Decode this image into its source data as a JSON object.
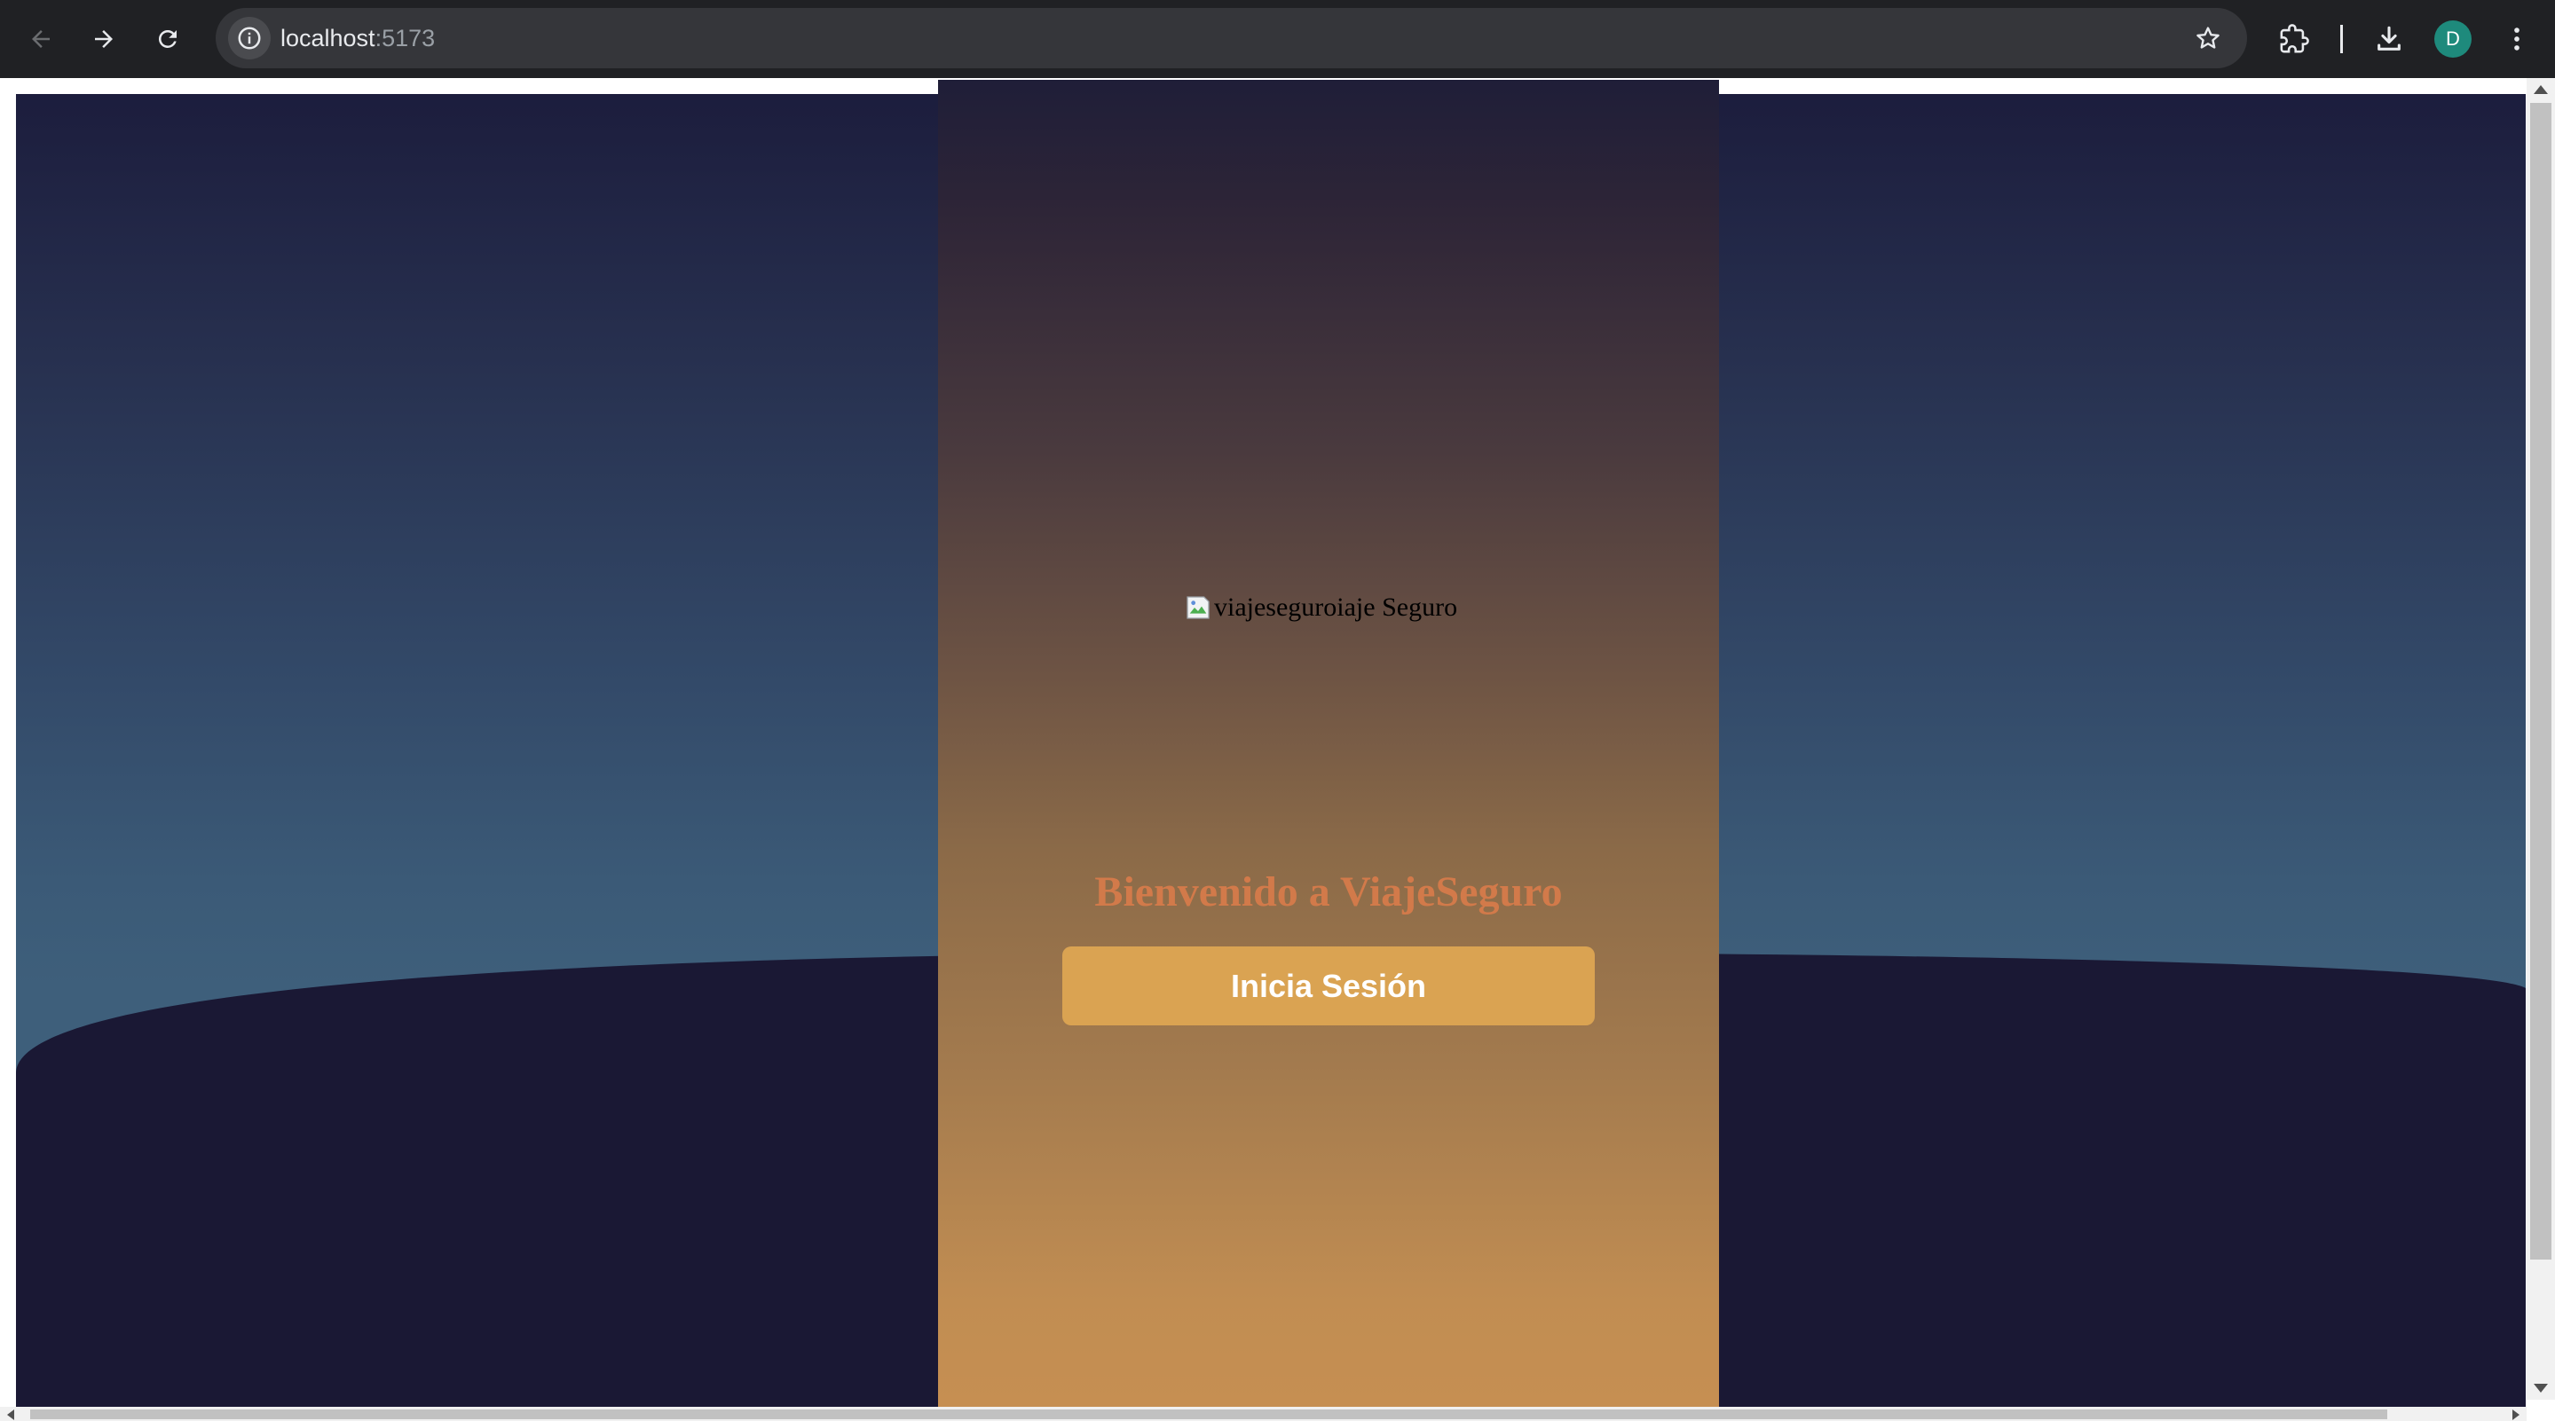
{
  "browser": {
    "url_host": "localhost",
    "url_port": ":5173",
    "profile_initial": "D",
    "icons": {
      "back": "arrow-left-icon",
      "forward": "arrow-right-icon",
      "reload": "reload-icon",
      "site_info": "info-icon",
      "bookmark": "star-icon",
      "extensions": "puzzle-icon",
      "downloads": "download-icon",
      "menu": "kebab-menu-icon"
    }
  },
  "page": {
    "logo_alt": "viajeseguroiaje Seguro",
    "welcome_title": "Bienvenido a ViajeSeguro",
    "login_button_label": "Inicia Sesión",
    "colors": {
      "title": "#d27a4a",
      "button": "#daa352",
      "background_dark": "#1a1834",
      "background_top": "#1c1d3d",
      "panel_bottom": "#c68f52"
    }
  }
}
